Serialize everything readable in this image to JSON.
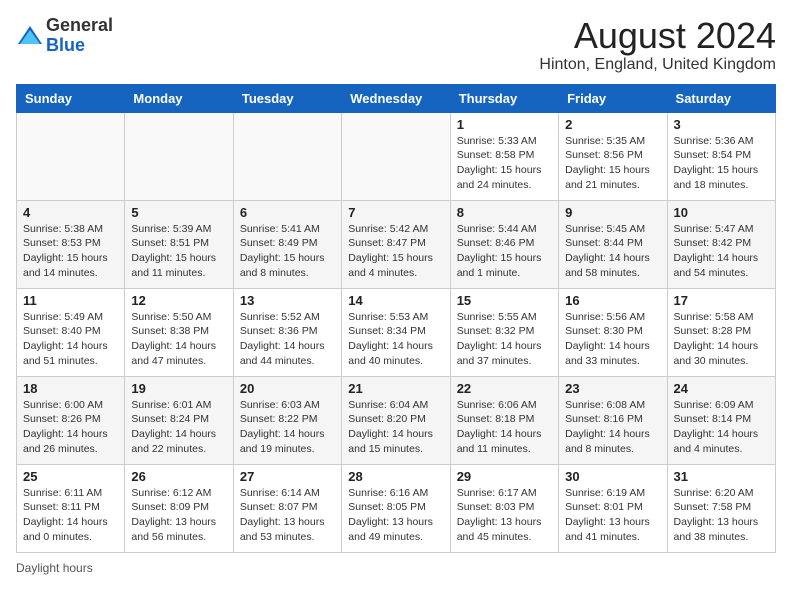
{
  "header": {
    "logo_line1": "General",
    "logo_line2": "Blue",
    "main_title": "August 2024",
    "subtitle": "Hinton, England, United Kingdom"
  },
  "days_of_week": [
    "Sunday",
    "Monday",
    "Tuesday",
    "Wednesday",
    "Thursday",
    "Friday",
    "Saturday"
  ],
  "weeks": [
    [
      {
        "day": "",
        "info": ""
      },
      {
        "day": "",
        "info": ""
      },
      {
        "day": "",
        "info": ""
      },
      {
        "day": "",
        "info": ""
      },
      {
        "day": "1",
        "info": "Sunrise: 5:33 AM\nSunset: 8:58 PM\nDaylight: 15 hours and 24 minutes."
      },
      {
        "day": "2",
        "info": "Sunrise: 5:35 AM\nSunset: 8:56 PM\nDaylight: 15 hours and 21 minutes."
      },
      {
        "day": "3",
        "info": "Sunrise: 5:36 AM\nSunset: 8:54 PM\nDaylight: 15 hours and 18 minutes."
      }
    ],
    [
      {
        "day": "4",
        "info": "Sunrise: 5:38 AM\nSunset: 8:53 PM\nDaylight: 15 hours and 14 minutes."
      },
      {
        "day": "5",
        "info": "Sunrise: 5:39 AM\nSunset: 8:51 PM\nDaylight: 15 hours and 11 minutes."
      },
      {
        "day": "6",
        "info": "Sunrise: 5:41 AM\nSunset: 8:49 PM\nDaylight: 15 hours and 8 minutes."
      },
      {
        "day": "7",
        "info": "Sunrise: 5:42 AM\nSunset: 8:47 PM\nDaylight: 15 hours and 4 minutes."
      },
      {
        "day": "8",
        "info": "Sunrise: 5:44 AM\nSunset: 8:46 PM\nDaylight: 15 hours and 1 minute."
      },
      {
        "day": "9",
        "info": "Sunrise: 5:45 AM\nSunset: 8:44 PM\nDaylight: 14 hours and 58 minutes."
      },
      {
        "day": "10",
        "info": "Sunrise: 5:47 AM\nSunset: 8:42 PM\nDaylight: 14 hours and 54 minutes."
      }
    ],
    [
      {
        "day": "11",
        "info": "Sunrise: 5:49 AM\nSunset: 8:40 PM\nDaylight: 14 hours and 51 minutes."
      },
      {
        "day": "12",
        "info": "Sunrise: 5:50 AM\nSunset: 8:38 PM\nDaylight: 14 hours and 47 minutes."
      },
      {
        "day": "13",
        "info": "Sunrise: 5:52 AM\nSunset: 8:36 PM\nDaylight: 14 hours and 44 minutes."
      },
      {
        "day": "14",
        "info": "Sunrise: 5:53 AM\nSunset: 8:34 PM\nDaylight: 14 hours and 40 minutes."
      },
      {
        "day": "15",
        "info": "Sunrise: 5:55 AM\nSunset: 8:32 PM\nDaylight: 14 hours and 37 minutes."
      },
      {
        "day": "16",
        "info": "Sunrise: 5:56 AM\nSunset: 8:30 PM\nDaylight: 14 hours and 33 minutes."
      },
      {
        "day": "17",
        "info": "Sunrise: 5:58 AM\nSunset: 8:28 PM\nDaylight: 14 hours and 30 minutes."
      }
    ],
    [
      {
        "day": "18",
        "info": "Sunrise: 6:00 AM\nSunset: 8:26 PM\nDaylight: 14 hours and 26 minutes."
      },
      {
        "day": "19",
        "info": "Sunrise: 6:01 AM\nSunset: 8:24 PM\nDaylight: 14 hours and 22 minutes."
      },
      {
        "day": "20",
        "info": "Sunrise: 6:03 AM\nSunset: 8:22 PM\nDaylight: 14 hours and 19 minutes."
      },
      {
        "day": "21",
        "info": "Sunrise: 6:04 AM\nSunset: 8:20 PM\nDaylight: 14 hours and 15 minutes."
      },
      {
        "day": "22",
        "info": "Sunrise: 6:06 AM\nSunset: 8:18 PM\nDaylight: 14 hours and 11 minutes."
      },
      {
        "day": "23",
        "info": "Sunrise: 6:08 AM\nSunset: 8:16 PM\nDaylight: 14 hours and 8 minutes."
      },
      {
        "day": "24",
        "info": "Sunrise: 6:09 AM\nSunset: 8:14 PM\nDaylight: 14 hours and 4 minutes."
      }
    ],
    [
      {
        "day": "25",
        "info": "Sunrise: 6:11 AM\nSunset: 8:11 PM\nDaylight: 14 hours and 0 minutes."
      },
      {
        "day": "26",
        "info": "Sunrise: 6:12 AM\nSunset: 8:09 PM\nDaylight: 13 hours and 56 minutes."
      },
      {
        "day": "27",
        "info": "Sunrise: 6:14 AM\nSunset: 8:07 PM\nDaylight: 13 hours and 53 minutes."
      },
      {
        "day": "28",
        "info": "Sunrise: 6:16 AM\nSunset: 8:05 PM\nDaylight: 13 hours and 49 minutes."
      },
      {
        "day": "29",
        "info": "Sunrise: 6:17 AM\nSunset: 8:03 PM\nDaylight: 13 hours and 45 minutes."
      },
      {
        "day": "30",
        "info": "Sunrise: 6:19 AM\nSunset: 8:01 PM\nDaylight: 13 hours and 41 minutes."
      },
      {
        "day": "31",
        "info": "Sunrise: 6:20 AM\nSunset: 7:58 PM\nDaylight: 13 hours and 38 minutes."
      }
    ]
  ],
  "footer": {
    "daylight_label": "Daylight hours"
  }
}
